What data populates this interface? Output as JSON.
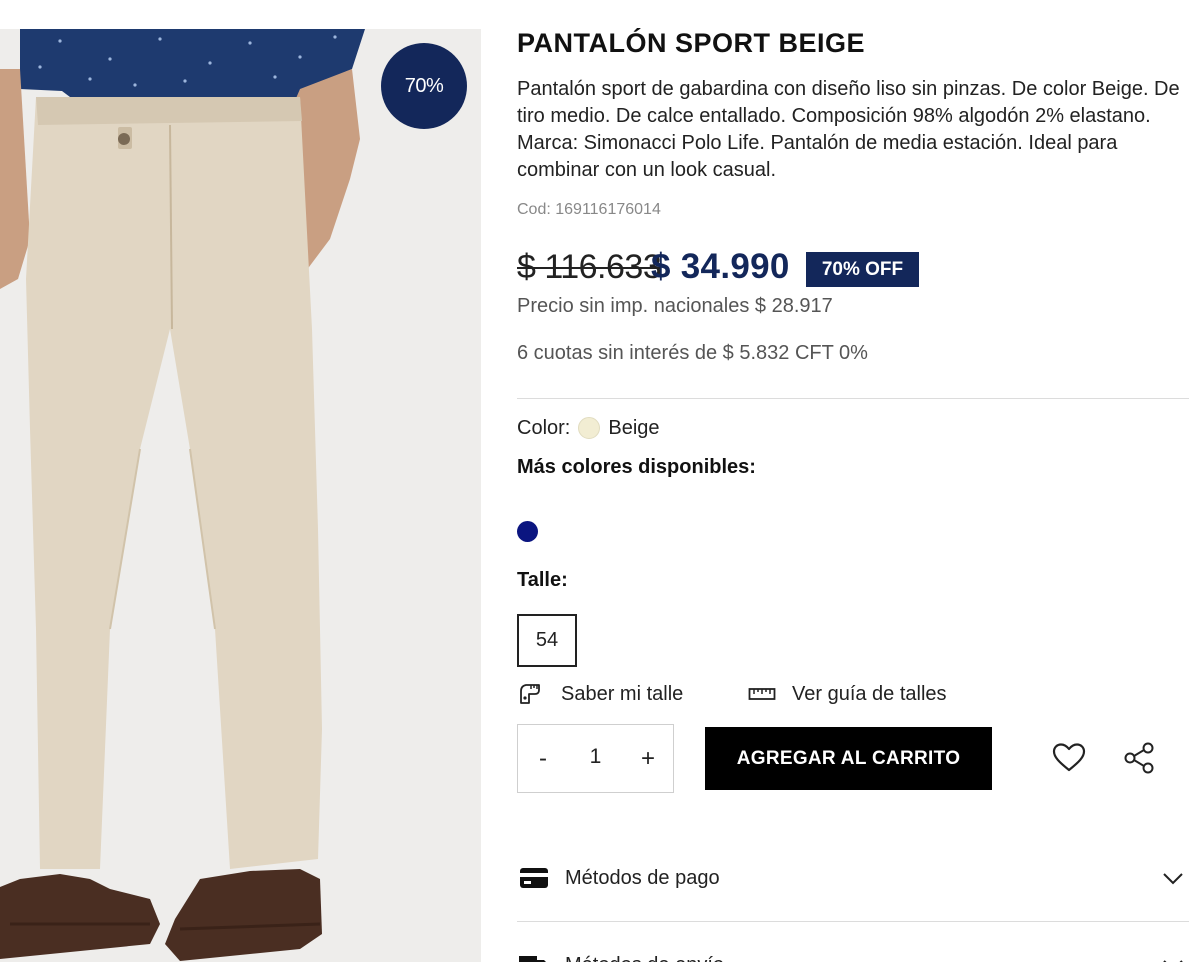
{
  "product": {
    "discount_circle": "70%",
    "title": "PANTALÓN SPORT BEIGE",
    "description": "Pantalón sport de gabardina con diseño liso sin pinzas. De color Beige. De tiro medio. De calce entallado. Composición 98% algodón 2% elastano. Marca: Simonacci Polo Life. Pantalón de media estación. Ideal para combinar con un look casual.",
    "code": "Cod: 169116176014",
    "old_price": "$ 116.633",
    "price": "$ 34.990",
    "off_badge": "70% OFF",
    "price_no_tax": "Precio sin imp. nacionales $ 28.917",
    "installments": "6 cuotas sin interés de $ 5.832 CFT 0%"
  },
  "color": {
    "label": "Color:",
    "value": "Beige",
    "swatch_hex": "#f2edd3",
    "more_label": "Más colores disponibles:",
    "other_swatches": [
      "#0b1580"
    ]
  },
  "size": {
    "label": "Talle:",
    "selected": "54"
  },
  "links": {
    "know_size": "Saber mi talle",
    "size_guide": "Ver guía de talles"
  },
  "quantity": {
    "minus": "-",
    "value": "1",
    "plus": "+"
  },
  "actions": {
    "add_to_cart": "AGREGAR AL CARRITO"
  },
  "accordions": {
    "payment": "Métodos de pago",
    "shipping": "Métodos de envío"
  },
  "colors": {
    "brand_navy": "#13275a",
    "cart_black": "#000000"
  },
  "icons": [
    "measure-tag-icon",
    "ruler-icon",
    "heart-icon",
    "share-icon",
    "credit-card-icon",
    "truck-icon",
    "chevron-down-icon"
  ]
}
